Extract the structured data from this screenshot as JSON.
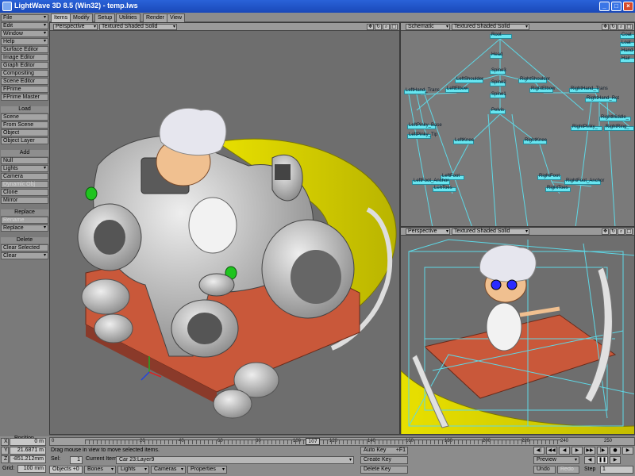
{
  "window": {
    "title": "LightWave 3D 8.5 (Win32) - temp.lws"
  },
  "tabs": [
    "Items",
    "Modify",
    "Setup",
    "Utilities",
    "Render",
    "View"
  ],
  "left_menu": {
    "top_items": [
      "File",
      "Edit",
      "Window",
      "Help",
      "Surface Editor",
      "Image Editor",
      "Graph Editor",
      "Compositing",
      "Scene Editor",
      "FPrime",
      "FPrime Master"
    ],
    "load_head": "Load",
    "load_items": [
      "Scene",
      "From Scene",
      "Object",
      "Object Layer"
    ],
    "add_head": "Add",
    "add_items": [
      "Null",
      "Lights",
      "Camera",
      "Dynamic Obj",
      "Clone",
      "Mirror"
    ],
    "replace_head": "Replace",
    "replace_items": [
      "Rename",
      "Replace"
    ],
    "delete_head": "Delete",
    "delete_items": [
      "Clear Selected",
      "Clear"
    ]
  },
  "viewports": {
    "main": {
      "view": "Perspective",
      "shading": "Textured Shaded Solid"
    },
    "top_right": {
      "view": "Schematic",
      "shading": "Textured Shaded Solid"
    },
    "bottom_right": {
      "view": "Perspective",
      "shading": "Textured Shaded Solid"
    }
  },
  "schematic_nodes": [
    "Root",
    "Head",
    "Spine3",
    "Spine2",
    "Spine1",
    "Pelvis",
    "LeftShoulder",
    "LeftElbow",
    "LeftHand_Trans",
    "RightShoulder",
    "RightElbow",
    "RightHand_Trans",
    "RightHand_Rot",
    "LeftPinky_Base",
    "LeftPinky_Tip",
    "LeftKnee",
    "RightKnee",
    "LeftFoot",
    "LeftFoot_Anchor",
    "LeftToes",
    "RightFoot",
    "RightFoot_Anchor",
    "RightToes",
    "RightMiddle_",
    "RightPinky_",
    "RightRing_",
    "Coat",
    "Loat",
    "Hand",
    "Hair"
  ],
  "bottom": {
    "position_label": "Position",
    "x_label": "X",
    "x_value": "0 m",
    "y_label": "Y",
    "y_value": "21.6871 m",
    "z_label": "Z",
    "z_value": "-851.212mm",
    "grid_label": "Grid:",
    "grid_value": "100 mm",
    "status": "Drag mouse in view to move selected items.",
    "sel_label": "Sel:",
    "sel_value": "1",
    "current_item_label": "Current Item",
    "current_item_value": "Car 23:Layer9",
    "objects": "Objects",
    "objects_count": "+0",
    "bones": "Bones",
    "lights": "Lights",
    "cameras": "Cameras",
    "properties": "Properties",
    "auto_key": "Auto Key",
    "auto_key_value": "+F1",
    "create_key": "Create Key",
    "delete_key": "Delete Key",
    "preview": "Preview",
    "undo": "Undo",
    "redo": "Redo",
    "step_label": "Step",
    "step_value": "1",
    "timeline_ticks": [
      "0",
      "20",
      "40",
      "60",
      "80",
      "100",
      "120",
      "140",
      "160",
      "180",
      "200",
      "220",
      "240"
    ],
    "timeline_end": "250",
    "current_frame": "107"
  }
}
